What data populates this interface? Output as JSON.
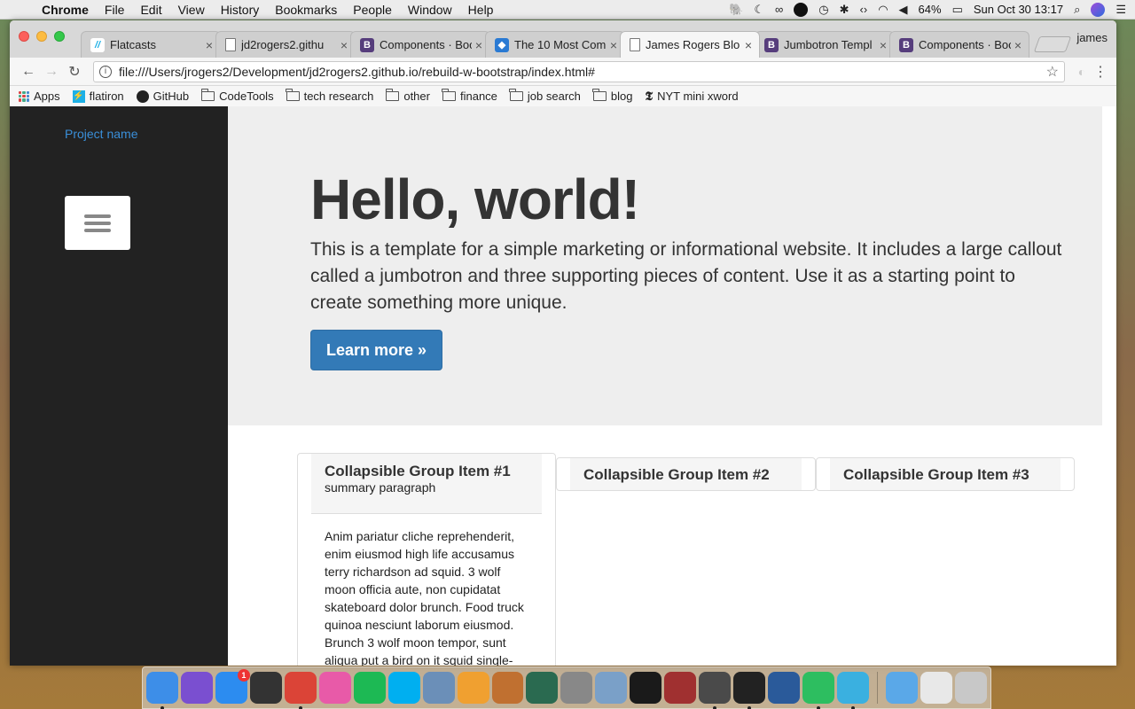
{
  "menubar": {
    "apple_icon": "apple-icon",
    "items": [
      "Chrome",
      "File",
      "Edit",
      "View",
      "History",
      "Bookmarks",
      "People",
      "Window",
      "Help"
    ],
    "battery": "64%",
    "clock": "Sun Oct 30  13:17"
  },
  "browser": {
    "tabs": [
      {
        "title": "Flatcasts",
        "favicon": "flatiron"
      },
      {
        "title": "jd2rogers2.githu",
        "favicon": "doc"
      },
      {
        "title": "Components · Boo",
        "favicon": "bootstrap"
      },
      {
        "title": "The 10 Most Com",
        "favicon": "blue"
      },
      {
        "title": "James Rogers Blo",
        "favicon": "doc"
      },
      {
        "title": "Jumbotron Templ",
        "favicon": "bootstrap"
      },
      {
        "title": "Components · Boo",
        "favicon": "bootstrap"
      }
    ],
    "active_tab_index": 4,
    "profile_name": "james",
    "url": "file:///Users/jrogers2/Development/jd2rogers2.github.io/rebuild-w-bootstrap/index.html#",
    "bookmarks": [
      {
        "label": "Apps",
        "type": "apps"
      },
      {
        "label": "flatiron",
        "type": "flatiron"
      },
      {
        "label": "GitHub",
        "type": "github"
      },
      {
        "label": "CodeTools",
        "type": "folder"
      },
      {
        "label": "tech research",
        "type": "folder"
      },
      {
        "label": "other",
        "type": "folder"
      },
      {
        "label": "finance",
        "type": "folder"
      },
      {
        "label": "job search",
        "type": "folder"
      },
      {
        "label": "blog",
        "type": "folder"
      },
      {
        "label": "NYT mini xword",
        "type": "nyt"
      }
    ]
  },
  "page": {
    "sidebar": {
      "project_name": "Project name",
      "menu_icon": "hamburger-icon"
    },
    "jumbotron": {
      "title": "Hello, world!",
      "lead": "This is a template for a simple marketing or informational website. It includes a large callout called a jumbotron and three supporting pieces of content. Use it as a starting point to create something more unique.",
      "button": "Learn more »"
    },
    "panels": [
      {
        "title": "Collapsible Group Item #1",
        "subtitle": "summary paragraph",
        "body": "Anim pariatur cliche reprehenderit, enim eiusmod high life accusamus terry richardson ad squid. 3 wolf moon officia aute, non cupidatat skateboard dolor brunch. Food truck quinoa nesciunt laborum eiusmod. Brunch 3 wolf moon tempor, sunt aliqua put a bird on it squid single-"
      },
      {
        "title": "Collapsible Group Item #2"
      },
      {
        "title": "Collapsible Group Item #3"
      }
    ]
  },
  "dock": {
    "apps": [
      {
        "name": "Finder",
        "color": "#3d8ee8",
        "running": true
      },
      {
        "name": "Siri",
        "color": "#7a4fd0",
        "running": false
      },
      {
        "name": "App Store",
        "color": "#2c8cf0",
        "running": false,
        "badge": "1"
      },
      {
        "name": "Dashboard",
        "color": "#333333",
        "running": false
      },
      {
        "name": "Chrome",
        "color": "#db4437",
        "running": true
      },
      {
        "name": "iTunes",
        "color": "#e85aa8",
        "running": false
      },
      {
        "name": "Spotify",
        "color": "#1db954",
        "running": false
      },
      {
        "name": "Skype",
        "color": "#00aff0",
        "running": false
      },
      {
        "name": "Preview",
        "color": "#6b8fb8",
        "running": false
      },
      {
        "name": "Photos",
        "color": "#f0a030",
        "running": false
      },
      {
        "name": "GarageBand",
        "color": "#c07030",
        "running": false
      },
      {
        "name": "Time Machine",
        "color": "#2a6a50",
        "running": false
      },
      {
        "name": "System Preferences",
        "color": "#888888",
        "running": false
      },
      {
        "name": "Preview 2",
        "color": "#7aa0c8",
        "running": false
      },
      {
        "name": "Kindle",
        "color": "#1a1a1a",
        "running": false
      },
      {
        "name": "Dictionary",
        "color": "#a03030",
        "running": false
      },
      {
        "name": "Sublime Text",
        "color": "#4a4a4a",
        "running": true
      },
      {
        "name": "Terminal",
        "color": "#222222",
        "running": true
      },
      {
        "name": "QuickTime",
        "color": "#2a5a9a",
        "running": false
      },
      {
        "name": "Evernote",
        "color": "#2dbe60",
        "running": true
      },
      {
        "name": "Spark",
        "color": "#3ab0e0",
        "running": true
      }
    ],
    "stacks": [
      {
        "name": "Applications",
        "color": "#5aa8e8"
      },
      {
        "name": "Documents",
        "color": "#e8e8e8"
      },
      {
        "name": "Trash",
        "color": "#c8c8c8"
      }
    ]
  }
}
